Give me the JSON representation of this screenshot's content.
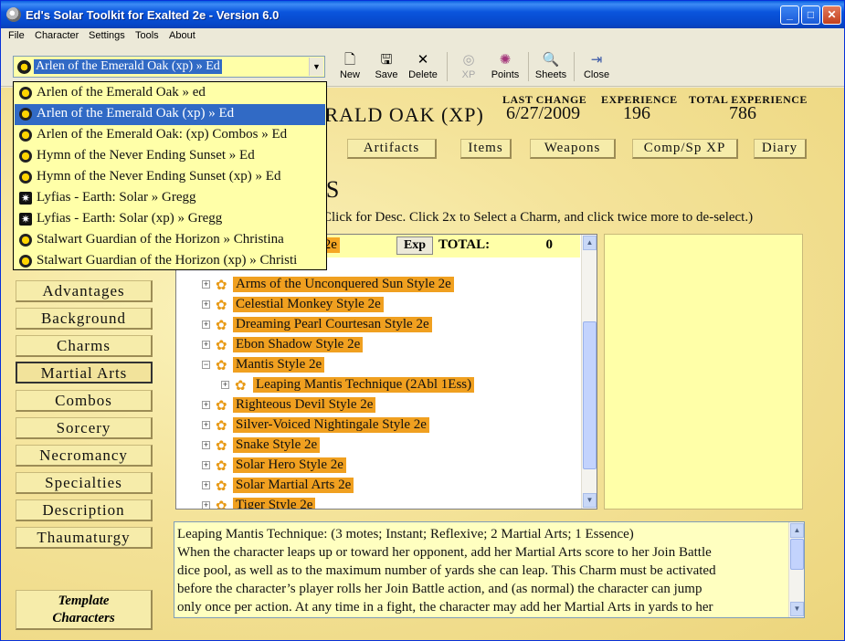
{
  "window": {
    "title": "Ed's Solar Toolkit for Exalted 2e - Version 6.0",
    "minimize": "_",
    "maximize": "□",
    "close": "✕"
  },
  "menu": [
    "File",
    "Character",
    "Settings",
    "Tools",
    "About"
  ],
  "combo": {
    "selected": "Arlen of the Emerald Oak (xp) » Ed",
    "arrow": "▼"
  },
  "toolbar": {
    "new": {
      "label": "New",
      "icon": "new-doc-icon"
    },
    "save": {
      "label": "Save",
      "icon": "floppy-icon"
    },
    "delete": {
      "label": "Delete",
      "icon": "x-icon"
    },
    "xp": {
      "label": "XP",
      "icon": "xp-disc-icon"
    },
    "points": {
      "label": "Points",
      "icon": "points-icon"
    },
    "sheets": {
      "label": "Sheets",
      "icon": "sheets-icon"
    },
    "close": {
      "label": "Close",
      "icon": "exit-door-icon"
    }
  },
  "header": {
    "char_name": "ERALD OAK (XP)",
    "last_change_label": "LAST CHANGE",
    "last_change": "6/27/2009",
    "experience_label": "EXPERIENCE",
    "experience": "196",
    "total_experience_label": "TOTAL EXPERIENCE",
    "total_experience": "786"
  },
  "tabs": [
    "Artifacts",
    "Items",
    "Weapons",
    "Comp/Sp XP",
    "Diary"
  ],
  "section": {
    "title": "TS",
    "instructions": "Click for Desc.  Click 2x to Select a Charm, and click twice more to de-select.)"
  },
  "sidebar": [
    "Advantages",
    "Background",
    "Charms",
    "Martial Arts",
    "Combos",
    "Sorcery",
    "Necromancy",
    "Specialties",
    "Description",
    "Thaumaturgy"
  ],
  "sidebar_active": "Martial Arts",
  "template_button": [
    "Template",
    "Characters"
  ],
  "tree": {
    "header_label": "rts 2e",
    "exp_button": "Exp",
    "total_label": "TOTAL:",
    "total_value": "0",
    "rows": [
      {
        "label": "Arms of the Unconquered Sun Style 2e",
        "expander": "+"
      },
      {
        "label": "Celestial Monkey Style 2e",
        "expander": "+"
      },
      {
        "label": "Dreaming Pearl Courtesan Style 2e",
        "expander": "+"
      },
      {
        "label": "Ebon Shadow Style 2e",
        "expander": "+"
      },
      {
        "label": "Mantis Style 2e",
        "expander": "−"
      },
      {
        "label": "Leaping Mantis Technique  (2Abl 1Ess)",
        "expander": "+"
      },
      {
        "label": "Righteous Devil Style 2e",
        "expander": "+"
      },
      {
        "label": "Silver-Voiced Nightingale Style 2e",
        "expander": "+"
      },
      {
        "label": "Snake Style 2e",
        "expander": "+"
      },
      {
        "label": "Solar Hero Style 2e",
        "expander": "+"
      },
      {
        "label": "Solar Martial Arts 2e",
        "expander": "+"
      },
      {
        "label": "Tiger Style 2e",
        "expander": "+"
      }
    ]
  },
  "description": {
    "lines": [
      "Leaping Mantis Technique: (3 motes; Instant; Reflexive; 2 Martial Arts; 1 Essence)",
      "When the character leaps up or toward her opponent, add her Martial Arts score to her Join Battle",
      "dice pool, as well as to the maximum number of yards she can leap. This Charm must be activated",
      "before the character’s player rolls her Join Battle action, and (as normal) the character can jump",
      "only once per action. At any time in a fight, the character may add her Martial Arts in yards to her"
    ]
  },
  "dropdown": [
    {
      "label": "Arlen of the Emerald Oak » ed",
      "icon": "sun-icon"
    },
    {
      "label": "Arlen of the Emerald Oak (xp) » Ed",
      "icon": "sun-icon"
    },
    {
      "label": "Arlen of the Emerald Oak: (xp) Combos » Ed",
      "icon": "sun-icon"
    },
    {
      "label": "Hymn of the Never Ending Sunset » Ed",
      "icon": "sun-icon"
    },
    {
      "label": "Hymn of the Never Ending Sunset (xp) » Ed",
      "icon": "sun-icon"
    },
    {
      "label": "Lyfias - Earth: Solar » Gregg",
      "icon": "star-icon"
    },
    {
      "label": "Lyfias - Earth: Solar (xp) » Gregg",
      "icon": "star-icon"
    },
    {
      "label": "Stalwart Guardian of the Horizon » Christina",
      "icon": "sun-icon"
    },
    {
      "label": "Stalwart Guardian of the Horizon (xp) » Christi",
      "icon": "sun-icon"
    }
  ],
  "dropdown_selected": "Arlen of the Emerald Oak (xp) » Ed",
  "colors": {
    "accent": "#316ac5",
    "tree_highlight": "#f0a020",
    "panel_yellow": "#ffffa8",
    "background_gold": "#f4e39a"
  }
}
